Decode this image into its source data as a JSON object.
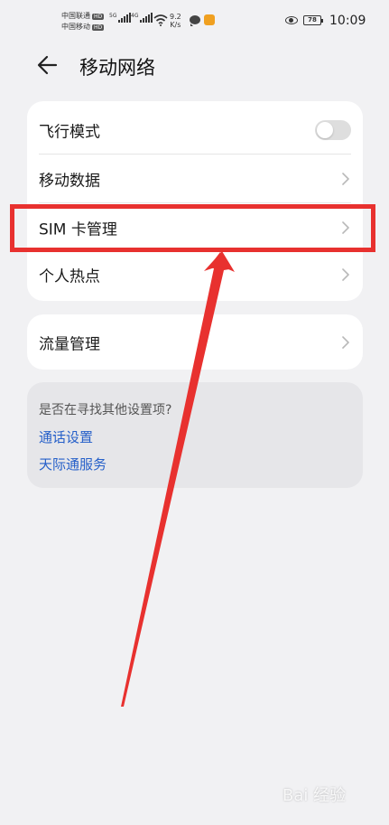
{
  "status_bar": {
    "carrier_1": "中国联通",
    "carrier_2": "中国移动",
    "hd_badge": "HD",
    "network_1": "5G",
    "network_2": "4G",
    "speed_value": "9.2",
    "speed_unit": "K/s",
    "battery": "78",
    "time": "10:09",
    "icons": [
      "signal-icon",
      "wifi-icon",
      "chat-icon",
      "app-icon",
      "eye-icon",
      "battery-icon"
    ]
  },
  "header": {
    "title": "移动网络",
    "back_icon": "arrow-left-icon"
  },
  "settings": {
    "airplane_mode": {
      "label": "飞行模式",
      "enabled": false
    },
    "mobile_data": {
      "label": "移动数据"
    },
    "sim_management": {
      "label": "SIM 卡管理"
    },
    "hotspot": {
      "label": "个人热点"
    },
    "data_usage": {
      "label": "流量管理"
    }
  },
  "suggestions": {
    "prompt": "是否在寻找其他设置项?",
    "links": [
      "通话设置",
      "天际通服务"
    ]
  },
  "annotation": {
    "highlight_color": "#e8312f",
    "arrow_color": "#e8312f"
  },
  "watermark": "Bai 经验"
}
